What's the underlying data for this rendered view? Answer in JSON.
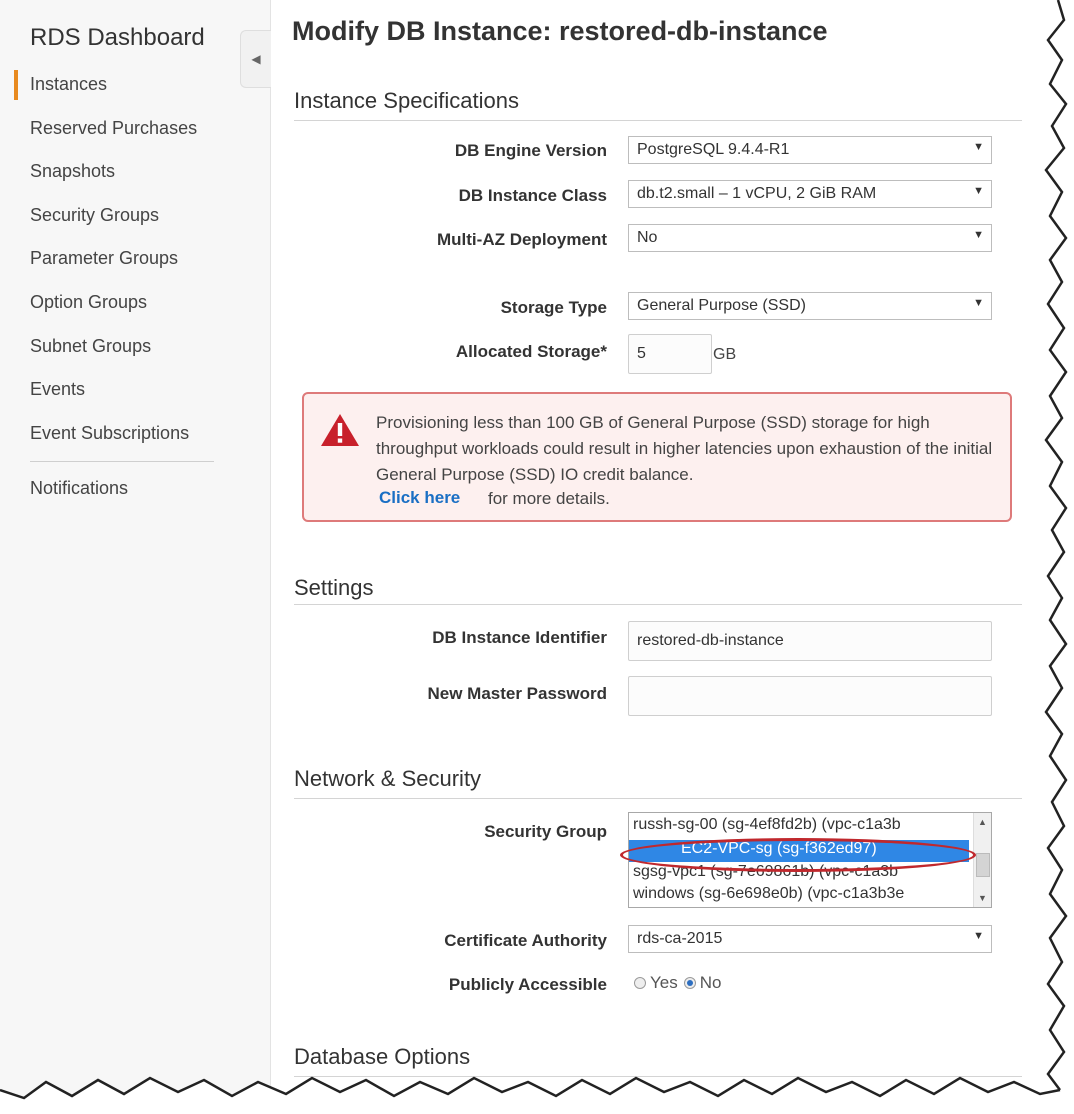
{
  "sidebar": {
    "title": "RDS Dashboard",
    "items": [
      {
        "label": "Instances"
      },
      {
        "label": "Reserved Purchases"
      },
      {
        "label": "Snapshots"
      },
      {
        "label": "Security Groups"
      },
      {
        "label": "Parameter Groups"
      },
      {
        "label": "Option Groups"
      },
      {
        "label": "Subnet Groups"
      },
      {
        "label": "Events"
      },
      {
        "label": "Event Subscriptions"
      },
      {
        "label": "Notifications"
      }
    ],
    "collapse_glyph": "◀",
    "active_color": "#e88a1f"
  },
  "page": {
    "title": "Modify DB Instance: restored-db-instance"
  },
  "instance_specs": {
    "heading": "Instance Specifications",
    "engine_version": {
      "label": "DB Engine Version",
      "value": "PostgreSQL 9.4.4-R1"
    },
    "instance_class": {
      "label": "DB Instance Class",
      "value": "db.t2.small – 1 vCPU, 2 GiB RAM"
    },
    "multi_az": {
      "label": "Multi-AZ Deployment",
      "value": "No"
    },
    "storage_type": {
      "label": "Storage Type",
      "value": "General Purpose (SSD)"
    },
    "allocated_storage": {
      "label": "Allocated Storage*",
      "value": "5",
      "unit": "GB"
    }
  },
  "warning": {
    "text": "Provisioning less than 100 GB of General Purpose (SSD) storage for high throughput workloads could result in higher latencies upon exhaustion of the initial General Purpose (SSD) IO credit balance.",
    "link": "Click here",
    "tail": "for more details.",
    "icon": "warning-triangle-icon",
    "border_color": "#de7a7a",
    "icon_color": "#c8202b"
  },
  "settings": {
    "heading": "Settings",
    "identifier": {
      "label": "DB Instance Identifier",
      "value": "restored-db-instance"
    },
    "password": {
      "label": "New Master Password",
      "value": ""
    }
  },
  "network": {
    "heading": "Network & Security",
    "security_group": {
      "label": "Security Group",
      "options": [
        "russh-sg-00 (sg-4ef8fd2b) (vpc-c1a3b",
        "EC2-VPC-sg (sg-f362ed97)",
        "sgsg-vpc1 (sg-7e69861b) (vpc-c1a3b",
        "windows (sg-6e698e0b) (vpc-c1a3b3e"
      ],
      "selected_index": 1,
      "selection_color": "#2f87e5",
      "highlight_color": "#c0282d"
    },
    "cert_authority": {
      "label": "Certificate Authority",
      "value": "rds-ca-2015"
    },
    "publicly_accessible": {
      "label": "Publicly Accessible",
      "options": [
        "Yes",
        "No"
      ],
      "selected": "No"
    }
  },
  "database_options": {
    "heading": "Database Options"
  }
}
